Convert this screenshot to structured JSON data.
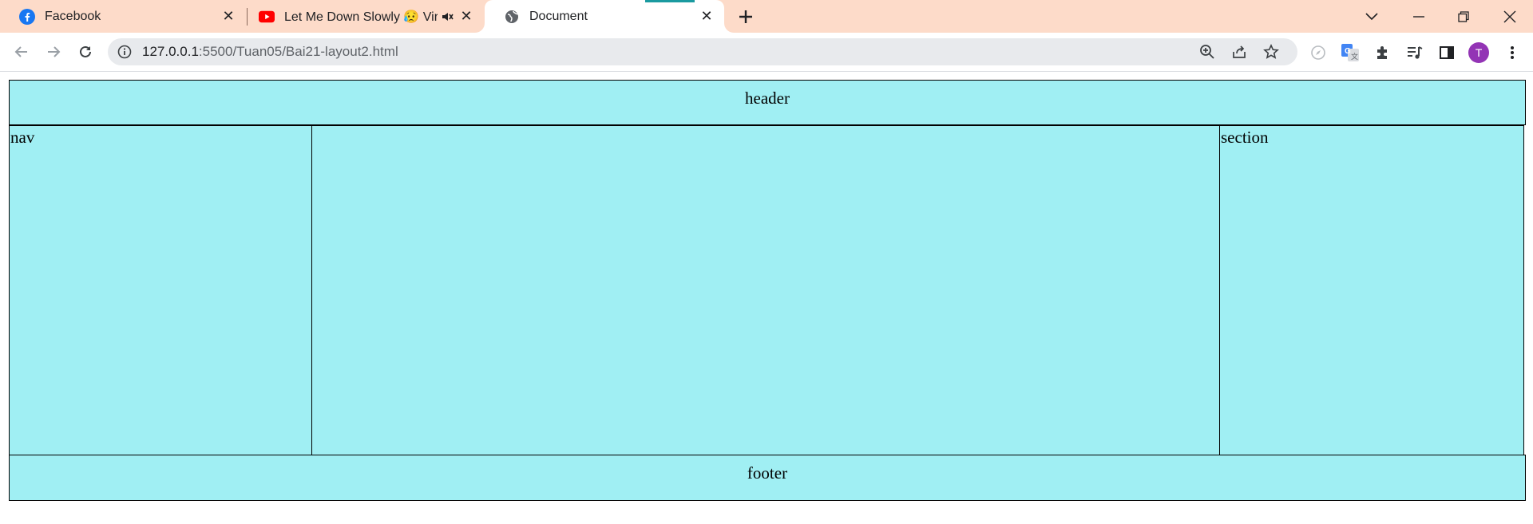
{
  "browser": {
    "tabs": [
      {
        "title": "Facebook",
        "icon": "facebook-icon"
      },
      {
        "title": "Let Me Down Slowly 😥 Vira",
        "icon": "youtube-icon",
        "audio_icon": "speaker-icon"
      },
      {
        "title": "Document",
        "icon": "globe-icon",
        "active": true
      }
    ],
    "address_bar": {
      "host": "127.0.0.1",
      "path": ":5500/Tuan05/Bai21-layout2.html"
    },
    "profile_initial": "T",
    "accent_colors": {
      "tabstrip": "#fddbc9",
      "avatar": "#9334b5",
      "loading": "#1a9aa0"
    }
  },
  "page": {
    "header": "header",
    "nav": "nav",
    "article": "",
    "section": "section",
    "footer": "footer",
    "box_color": "#a0eff3"
  }
}
